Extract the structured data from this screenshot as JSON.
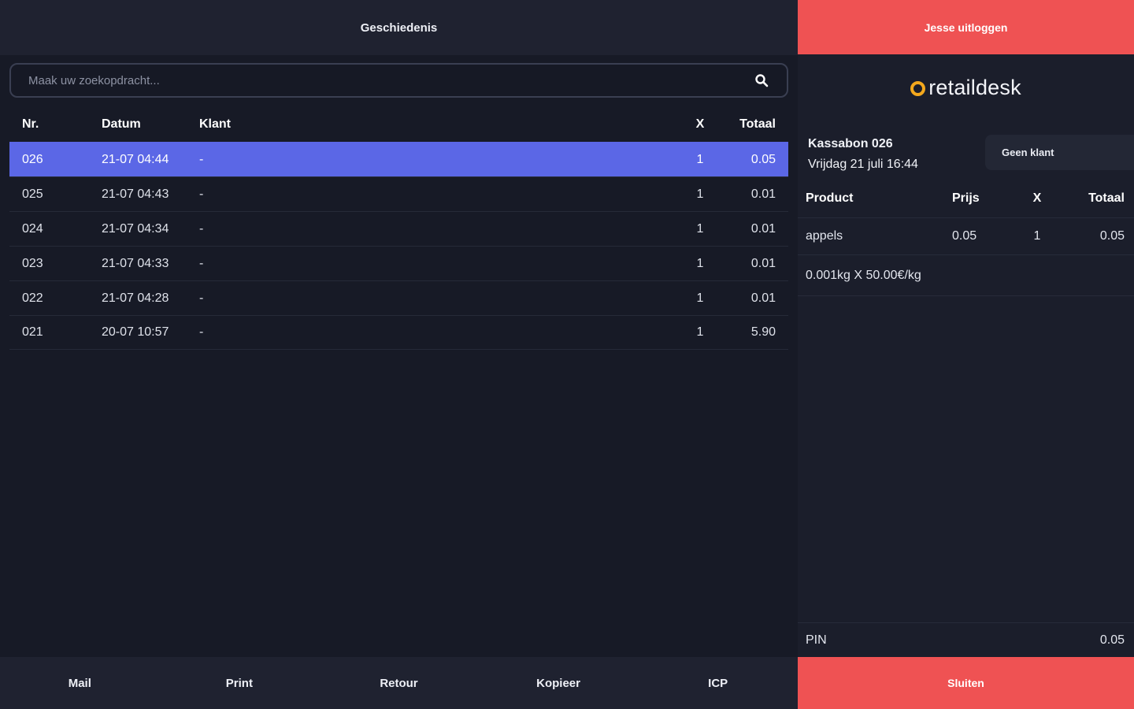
{
  "header": {
    "title": "Geschiedenis"
  },
  "search": {
    "placeholder": "Maak uw zoekopdracht...",
    "value": ""
  },
  "table": {
    "columns": {
      "nr": "Nr.",
      "datum": "Datum",
      "klant": "Klant",
      "x": "X",
      "totaal": "Totaal"
    },
    "rows": [
      {
        "nr": "026",
        "datum": "21-07 04:44",
        "klant": "-",
        "x": "1",
        "totaal": "0.05"
      },
      {
        "nr": "025",
        "datum": "21-07 04:43",
        "klant": "-",
        "x": "1",
        "totaal": "0.01"
      },
      {
        "nr": "024",
        "datum": "21-07 04:34",
        "klant": "-",
        "x": "1",
        "totaal": "0.01"
      },
      {
        "nr": "023",
        "datum": "21-07 04:33",
        "klant": "-",
        "x": "1",
        "totaal": "0.01"
      },
      {
        "nr": "022",
        "datum": "21-07 04:28",
        "klant": "-",
        "x": "1",
        "totaal": "0.01"
      },
      {
        "nr": "021",
        "datum": "20-07 10:57",
        "klant": "-",
        "x": "1",
        "totaal": "5.90"
      }
    ]
  },
  "footer": {
    "buttons": [
      "Mail",
      "Print",
      "Retour",
      "Kopieer",
      "ICP"
    ]
  },
  "right": {
    "logout_label": "Jesse uitloggen",
    "logo_text": "retaildesk",
    "receipt": {
      "title": "Kassabon 026",
      "date": "Vrijdag 21 juli 16:44"
    },
    "customer_label": "Geen klant",
    "columns": {
      "product": "Product",
      "prijs": "Prijs",
      "x": "X",
      "totaal": "Totaal"
    },
    "items": [
      {
        "product": "appels",
        "prijs": "0.05",
        "x": "1",
        "totaal": "0.05",
        "detail": "0.001kg X 50.00€/kg"
      }
    ],
    "payment": {
      "method": "PIN",
      "amount": "0.05"
    },
    "close_label": "Sluiten"
  },
  "colors": {
    "accent_red": "#ef5253",
    "selected_row": "#5b67e6",
    "logo_ring": "#f4a81d",
    "background": "#171a26"
  }
}
